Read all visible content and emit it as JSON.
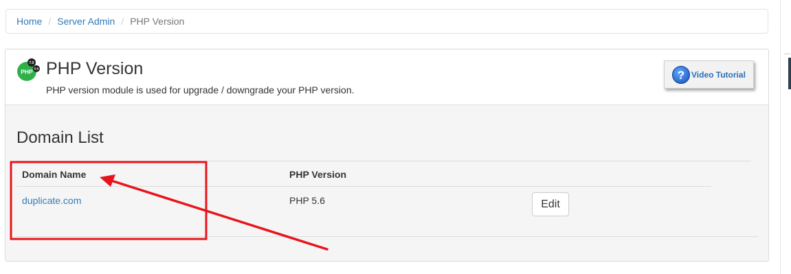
{
  "breadcrumb": {
    "home": "Home",
    "server_admin": "Server Admin",
    "current": "PHP Version",
    "separator": "/"
  },
  "header": {
    "logo_text": "PHP",
    "logo_badge_top": "7.0",
    "logo_badge_right": "5.6",
    "title": "PHP Version",
    "subtitle": "PHP version module is used for upgrade / downgrade your PHP version.",
    "video_icon": "?",
    "video_label": "Video Tutorial"
  },
  "domain_list": {
    "title": "Domain List",
    "columns": [
      "Domain Name",
      "PHP Version"
    ],
    "rows": [
      {
        "domain": "duplicate.com",
        "php_version": "PHP 5.6",
        "action": "Edit"
      }
    ]
  },
  "annotation": {
    "color": "#e8141b",
    "shape": "highlight-box-with-arrow"
  },
  "colors": {
    "link": "#337ab7",
    "logo_green": "#2fb14a",
    "panel_bg": "#f5f5f5"
  }
}
